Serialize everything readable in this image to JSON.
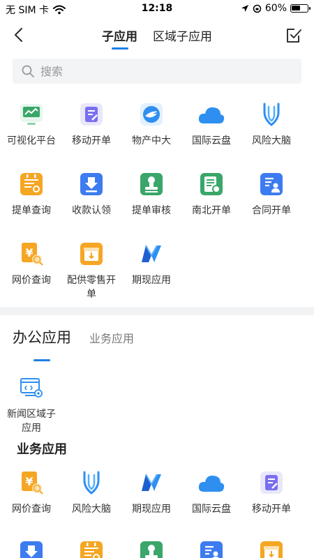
{
  "status_bar": {
    "carrier": "无 SIM 卡",
    "time": "12:18",
    "battery": "60%",
    "battery_level": 0.6
  },
  "nav": {
    "tabs": [
      {
        "label": "子应用",
        "active": true
      },
      {
        "label": "区域子应用",
        "active": false
      }
    ],
    "back_icon": "chevron-left-icon",
    "edit_icon": "checkbox-edit-icon"
  },
  "search": {
    "placeholder": "搜索",
    "value": ""
  },
  "sub_apps": [
    {
      "label": "可视化平台",
      "icon": "dashboard-icon"
    },
    {
      "label": "移动开单",
      "icon": "edit-doc-icon"
    },
    {
      "label": "物产中大",
      "icon": "company-logo-icon"
    },
    {
      "label": "国际云盘",
      "icon": "cloud-icon"
    },
    {
      "label": "风险大脑",
      "icon": "brain-icon"
    },
    {
      "label": "提单查询",
      "icon": "calendar-doc-icon"
    },
    {
      "label": "收款认领",
      "icon": "download-icon"
    },
    {
      "label": "提单审核",
      "icon": "stamp-icon"
    },
    {
      "label": "南北开单",
      "icon": "invoice-icon"
    },
    {
      "label": "合同开单",
      "icon": "contract-icon"
    },
    {
      "label": "网价查询",
      "icon": "price-search-icon"
    },
    {
      "label": "配供零售开单",
      "icon": "box-icon"
    },
    {
      "label": "期现应用",
      "icon": "futures-logo-icon"
    }
  ],
  "office_section": {
    "tabs": [
      {
        "label": "办公应用",
        "active": true
      },
      {
        "label": "业务应用",
        "active": false
      }
    ],
    "apps": [
      {
        "label": "新闻区域子应用",
        "icon": "news-settings-icon"
      }
    ]
  },
  "business_section": {
    "heading": "业务应用",
    "apps": [
      {
        "label": "网价查询",
        "icon": "price-search-icon"
      },
      {
        "label": "风险大脑",
        "icon": "brain-icon"
      },
      {
        "label": "期现应用",
        "icon": "futures-logo-icon"
      },
      {
        "label": "国际云盘",
        "icon": "cloud-icon"
      },
      {
        "label": "移动开单",
        "icon": "edit-doc-icon"
      },
      {
        "label": "",
        "icon": "download-icon"
      },
      {
        "label": "",
        "icon": "calendar-doc-icon"
      },
      {
        "label": "",
        "icon": "stamp-icon"
      },
      {
        "label": "",
        "icon": "contract-icon"
      },
      {
        "label": "",
        "icon": "box-icon"
      }
    ]
  },
  "colors": {
    "accent": "#1e7fe6",
    "orange": "#f5a623",
    "blue": "#3d7bf0",
    "green": "#3aa66a",
    "cloud": "#2f8ff0",
    "divider": "#f2f3f5"
  }
}
